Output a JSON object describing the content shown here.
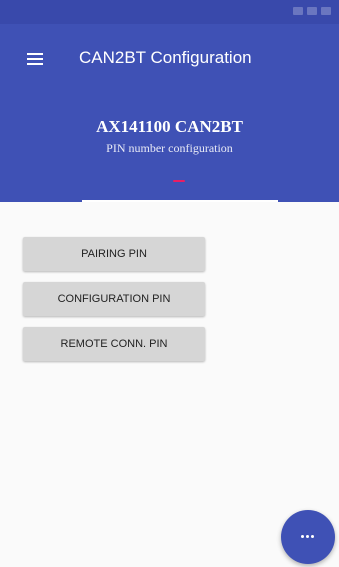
{
  "app_bar": {
    "title": "CAN2BT Configuration",
    "menu_icon": "hamburger-menu-icon",
    "color": "#3f51b5"
  },
  "header": {
    "device_title": "AX141100 CAN2BT",
    "subtitle": "PIN number configuration",
    "indicator_color": "#e91e63"
  },
  "buttons": {
    "pairing_pin": "PAIRING PIN",
    "configuration_pin": "CONFIGURATION PIN",
    "remote_conn_pin": "REMOTE CONN. PIN"
  },
  "fab": {
    "icon": "more-horizontal-icon",
    "color": "#3f51b5"
  }
}
